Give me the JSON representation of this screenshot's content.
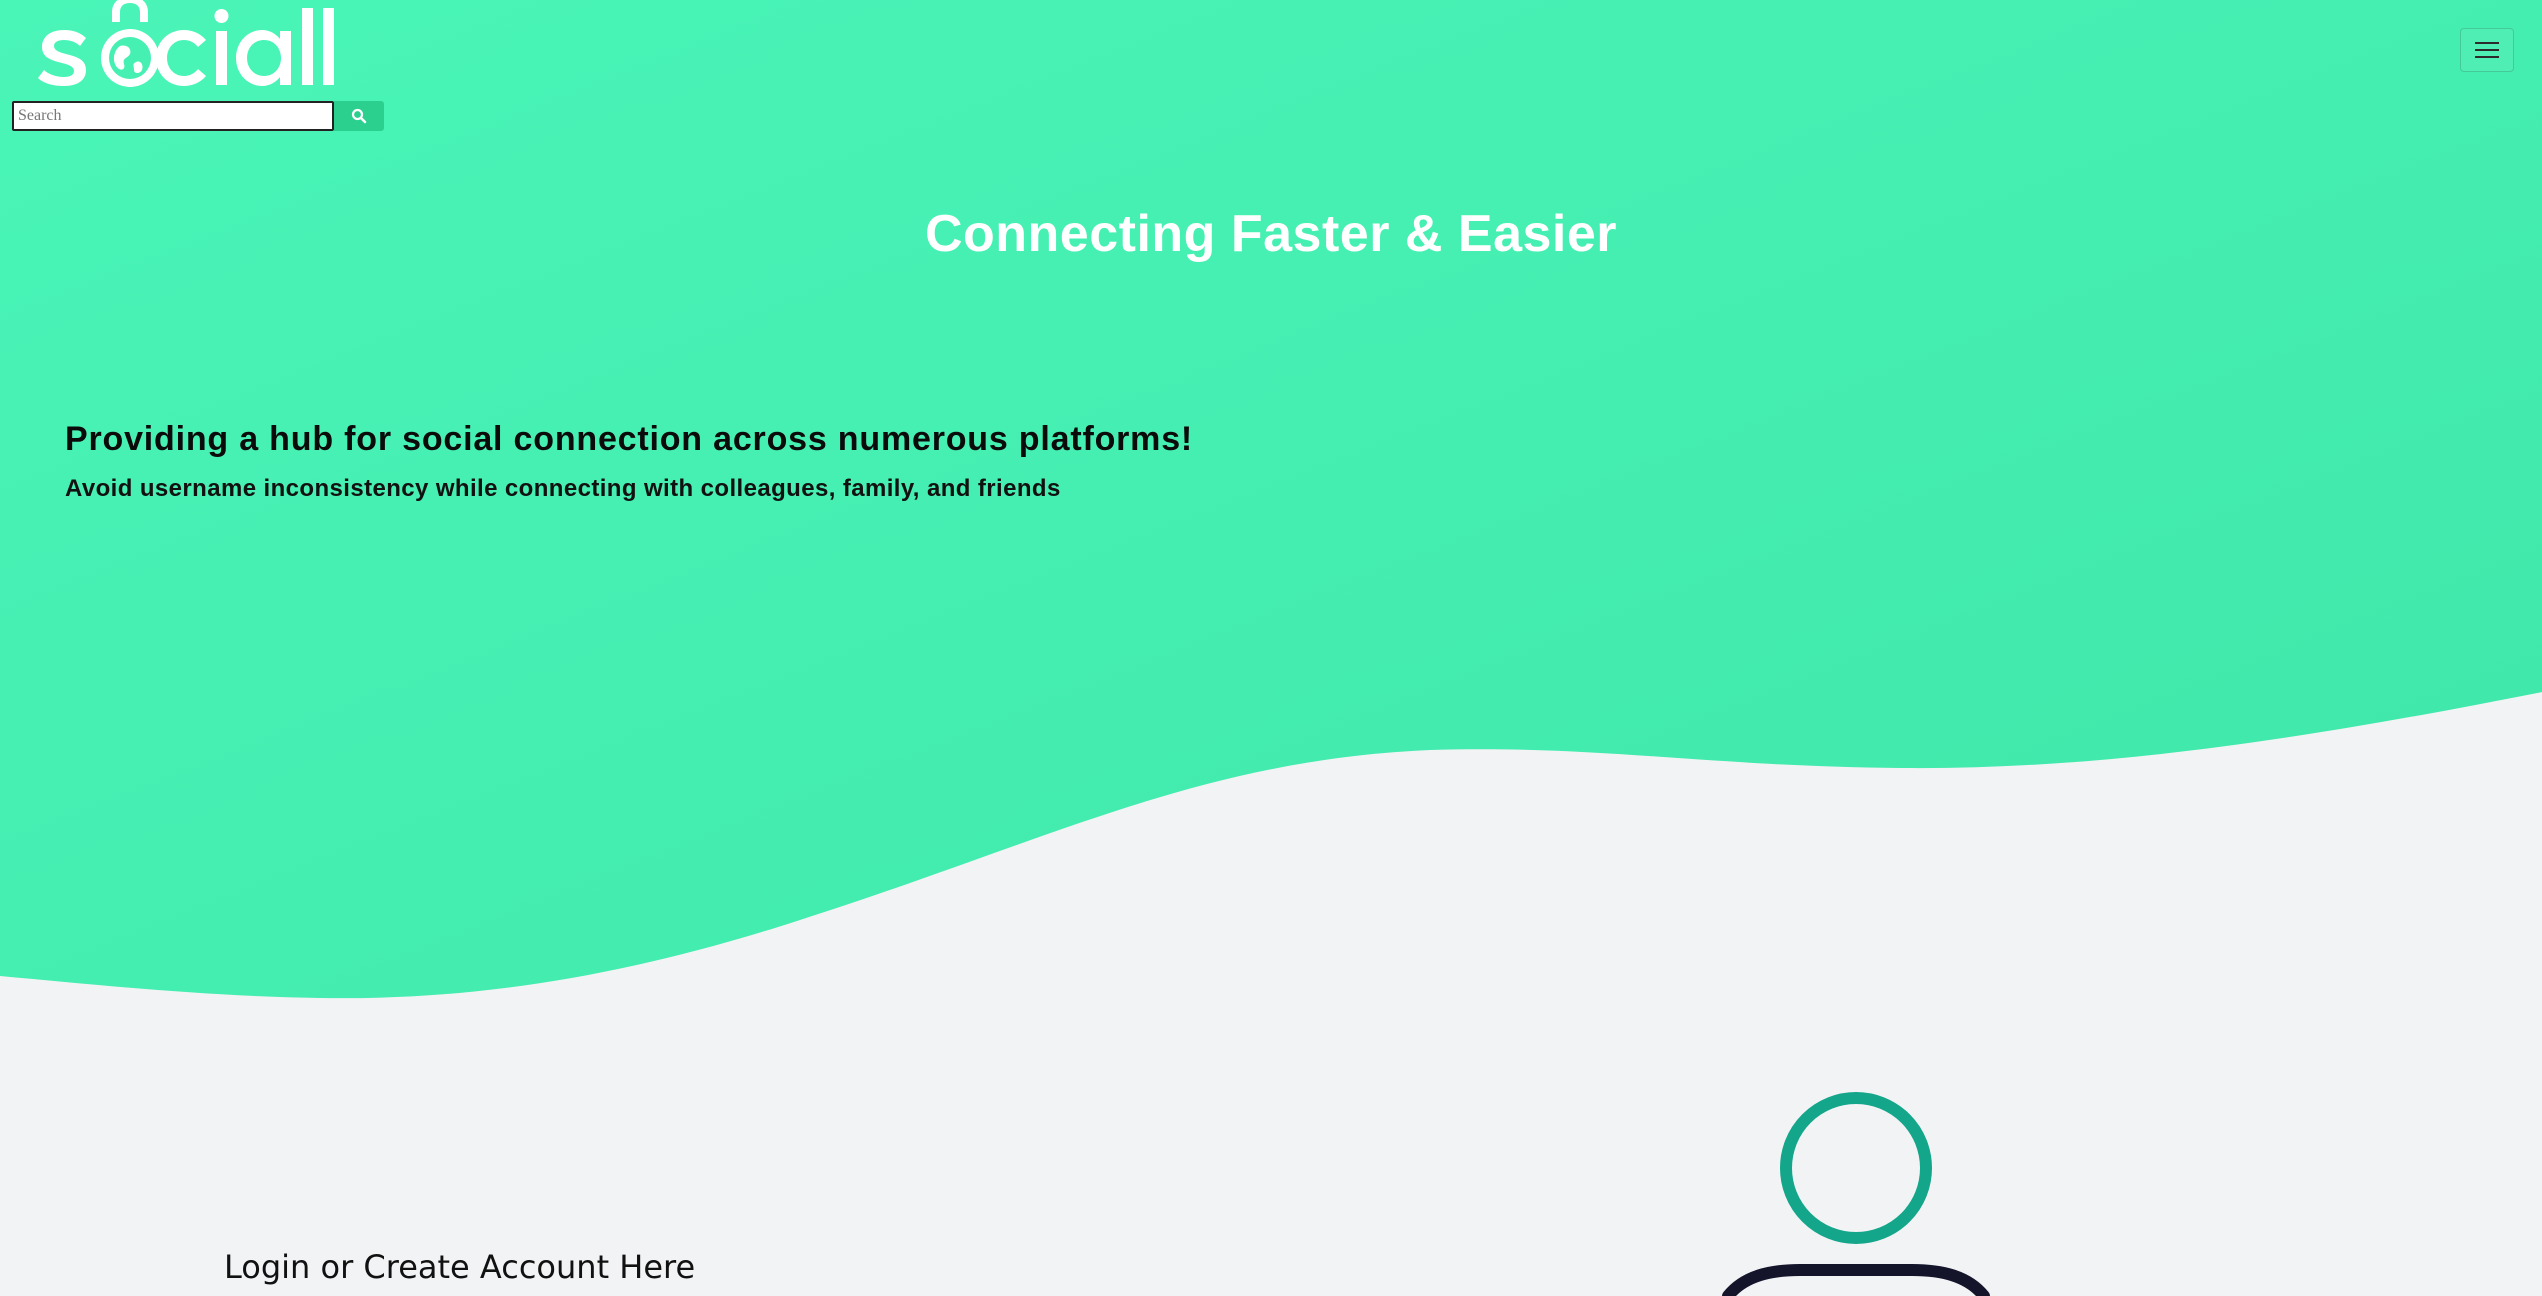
{
  "brand": {
    "logo_text": "sociall"
  },
  "search": {
    "placeholder": "Search",
    "value": "",
    "button_icon": "search-icon"
  },
  "nav": {
    "menu_icon": "hamburger-menu-icon"
  },
  "hero": {
    "title": "Connecting Faster & Easier",
    "tagline": "Providing a hub for social connection across numerous platforms!",
    "subtagline": "Avoid username inconsistency while connecting with colleagues, family, and friends"
  },
  "account": {
    "heading": "Login or Create Account Here"
  },
  "colors": {
    "hero_green": "#46f0b2",
    "hero_green_dark": "#3fe6a9",
    "page_bg": "#f2f3f5",
    "accent_teal": "#13a68a",
    "dark_navy": "#14142b",
    "search_button": "#2bd08f"
  }
}
